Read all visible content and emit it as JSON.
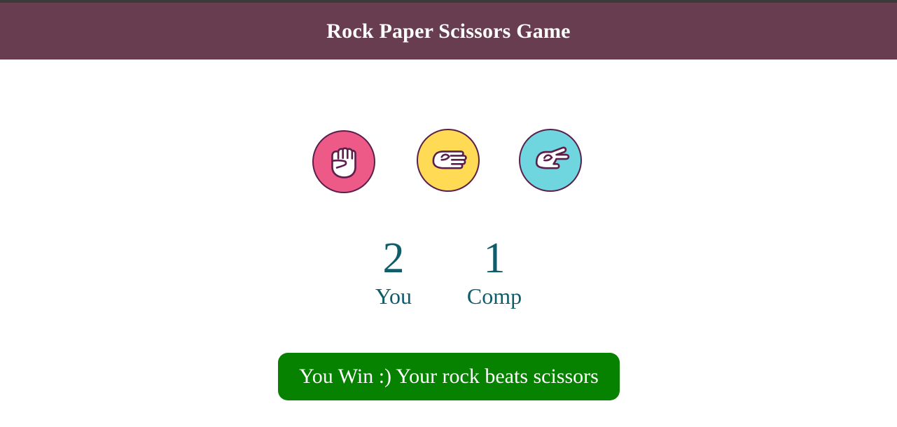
{
  "header": {
    "title": "Rock Paper Scissors Game"
  },
  "choices": [
    {
      "name": "rock",
      "color": "#ee5a87",
      "icon": "rock-hand-icon"
    },
    {
      "name": "paper",
      "color": "#ffda55",
      "icon": "paper-hand-icon"
    },
    {
      "name": "scissors",
      "color": "#6fd6df",
      "icon": "scissors-hand-icon"
    }
  ],
  "scoreboard": {
    "user_score": "2",
    "user_label": "You",
    "comp_score": "1",
    "comp_label": "Comp"
  },
  "result": {
    "message": "You Win :) Your rock beats scissors",
    "status_color": "#068100"
  }
}
